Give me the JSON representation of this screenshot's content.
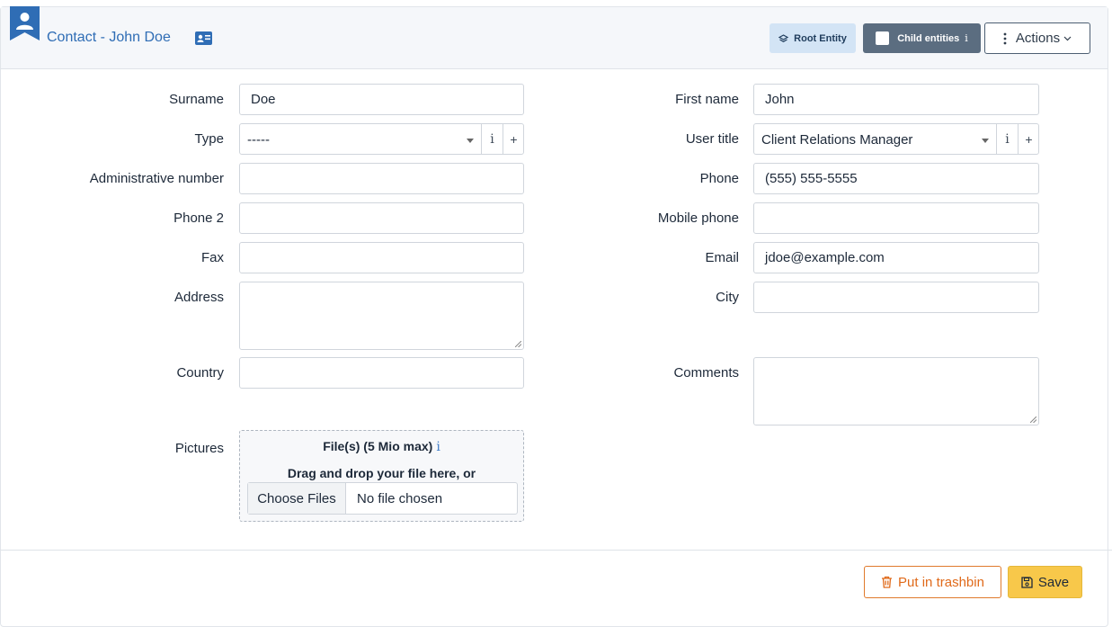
{
  "header": {
    "title": "Contact - John Doe",
    "root_entity_label": "Root Entity",
    "child_entities_label": "Child entities",
    "child_entities_info": "i",
    "actions_label": "Actions"
  },
  "form": {
    "left": {
      "surname_label": "Surname",
      "surname_value": "Doe",
      "type_label": "Type",
      "type_value": "-----",
      "admin_number_label": "Administrative number",
      "admin_number_value": "",
      "phone2_label": "Phone 2",
      "phone2_value": "",
      "fax_label": "Fax",
      "fax_value": "",
      "address_label": "Address",
      "address_value": "",
      "country_label": "Country",
      "country_value": "",
      "pictures_label": "Pictures"
    },
    "right": {
      "first_name_label": "First name",
      "first_name_value": "John",
      "user_title_label": "User title",
      "user_title_value": "Client Relations Manager",
      "phone_label": "Phone",
      "phone_value": "(555) 555-5555",
      "mobile_label": "Mobile phone",
      "mobile_value": "",
      "email_label": "Email",
      "email_value": "jdoe@example.com",
      "city_label": "City",
      "city_value": "",
      "comments_label": "Comments",
      "comments_value": ""
    },
    "select_info_glyph": "i",
    "select_add_glyph": "+"
  },
  "upload": {
    "title": "File(s) (5 Mio max)",
    "info_glyph": "i",
    "drag_text": "Drag and drop your file here, or",
    "choose_button": "Choose Files",
    "no_file_text": "No file chosen"
  },
  "footer": {
    "trash_label": "Put in trashbin",
    "save_label": "Save"
  },
  "colors": {
    "accent": "#2f6db5",
    "trash": "#e06a1a",
    "save": "#f8c84a",
    "child_button": "#5b6d80",
    "root_button": "#d3e4f5"
  },
  "icons": [
    "contact-ribbon-icon",
    "id-card-icon",
    "layers-icon",
    "kebab-icon",
    "chevron-down-icon",
    "trash-icon",
    "floppy-disk-icon"
  ]
}
